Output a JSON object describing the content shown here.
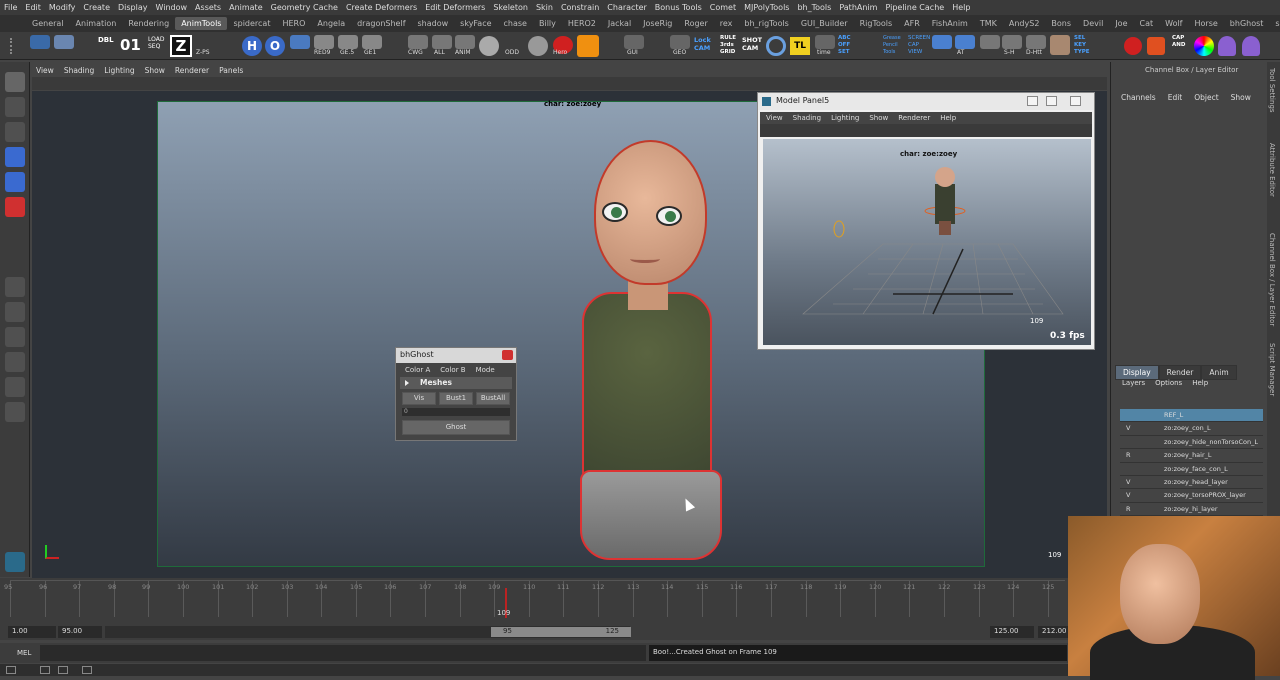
{
  "menubar": [
    "File",
    "Edit",
    "Modify",
    "Create",
    "Display",
    "Window",
    "Assets",
    "Animate",
    "Geometry Cache",
    "Create Deformers",
    "Edit Deformers",
    "Skeleton",
    "Skin",
    "Constrain",
    "Character",
    "Bonus Tools",
    "Comet",
    "MJPolyTools",
    "bh_Tools",
    "PathAnim",
    "Pipeline Cache",
    "Help"
  ],
  "shelf_tabs": [
    "General",
    "Animation",
    "Rendering",
    "AnimTools",
    "spidercat",
    "HERO",
    "Angela",
    "dragonShelf",
    "shadow",
    "skyFace",
    "chase",
    "Billy",
    "HERO2",
    "Jackal",
    "JoseRig",
    "Roger",
    "rex",
    "bh_rigTools",
    "GUI_Builder",
    "RigTools",
    "AFR",
    "FishAnim",
    "TMK",
    "AndyS2",
    "Bons",
    "Devil",
    "Joe",
    "Cat",
    "Wolf",
    "Horse",
    "bhGhost",
    "soup"
  ],
  "active_shelf_tab": "AnimTools",
  "shelf_labels": [
    "DBL",
    "01",
    "LOAD SEQ",
    "Z-PS",
    "H",
    "O",
    "RED9",
    "GE.5",
    "GE1",
    "CWG",
    "ALL",
    "ANIM",
    "ODD",
    "Hero",
    "GUI",
    "GEO",
    "Lock CAM",
    "RULE 3rds GRID",
    "SHOT CAM",
    "TL",
    "time",
    "ABC OFF SET",
    "Grease Pencil Tools",
    "SCREEN CAP VIEW",
    "AT",
    "S-H",
    "D-Htt",
    "SEL KEY TYPE",
    "CAP AND",
    "AT"
  ],
  "viewport": {
    "menu": [
      "View",
      "Shading",
      "Lighting",
      "Show",
      "Renderer",
      "Panels"
    ],
    "char_label": "char: zoe:zoey",
    "frame_overlay": "109"
  },
  "model_panel": {
    "title": "Model Panel5",
    "menu": [
      "View",
      "Shading",
      "Lighting",
      "Show",
      "Renderer",
      "Help"
    ],
    "char_label": "char: zoe:zoey",
    "frame": "109",
    "fps": "0.3 fps"
  },
  "bhghost": {
    "title": "bhGhost",
    "menu": [
      "Color A",
      "Color B",
      "Mode"
    ],
    "section": "Meshes",
    "buttons": [
      "Vis",
      "Bust1",
      "BustAll"
    ],
    "slider_value": "0",
    "ghost_button": "Ghost"
  },
  "channel_box": {
    "title": "Channel Box / Layer Editor",
    "menu": [
      "Channels",
      "Edit",
      "Object",
      "Show"
    ],
    "side_tabs": [
      "Tool Settings",
      "Attribute Editor",
      "Channel Box / Layer Editor",
      "Script Manager"
    ]
  },
  "layer_editor": {
    "tabs": [
      "Display",
      "Render",
      "Anim"
    ],
    "active_tab": "Display",
    "menu": [
      "Layers",
      "Options",
      "Help"
    ],
    "layers": [
      {
        "vis": "",
        "name": "REF_L",
        "selected": true
      },
      {
        "vis": "V",
        "name": "zo:zoey_con_L",
        "selected": false
      },
      {
        "vis": "",
        "name": "zo:zoey_hide_nonTorsoCon_L",
        "selected": false
      },
      {
        "vis": "R",
        "name": "zo:zoey_hair_L",
        "selected": false
      },
      {
        "vis": "",
        "name": "zo:zoey_face_con_L",
        "selected": false
      },
      {
        "vis": "V",
        "name": "zo:zoey_head_layer",
        "selected": false
      },
      {
        "vis": "V",
        "name": "zo:zoey_torsoPROX_layer",
        "selected": false
      },
      {
        "vis": "R",
        "name": "zo:zoey_hi_layer",
        "selected": false
      }
    ]
  },
  "timeline": {
    "ticks": [
      "95",
      "96",
      "97",
      "98",
      "99",
      "100",
      "101",
      "102",
      "103",
      "104",
      "105",
      "106",
      "107",
      "108",
      "109",
      "110",
      "111",
      "112",
      "113",
      "114",
      "115",
      "116",
      "117",
      "118",
      "119",
      "120",
      "121",
      "122",
      "123",
      "124",
      "125"
    ],
    "current_frame": "109",
    "start": "1.00",
    "range_start": "95.00",
    "slider_start": "95",
    "slider_end": "125",
    "range_end": "125.00",
    "end": "212.00"
  },
  "command_line": {
    "label": "MEL",
    "result": "Boo!...Created Ghost on Frame 109"
  },
  "colors": {
    "accent": "#5285a6",
    "ghost_outline": "#d33333",
    "shelf_active": "#5a5a5a"
  }
}
